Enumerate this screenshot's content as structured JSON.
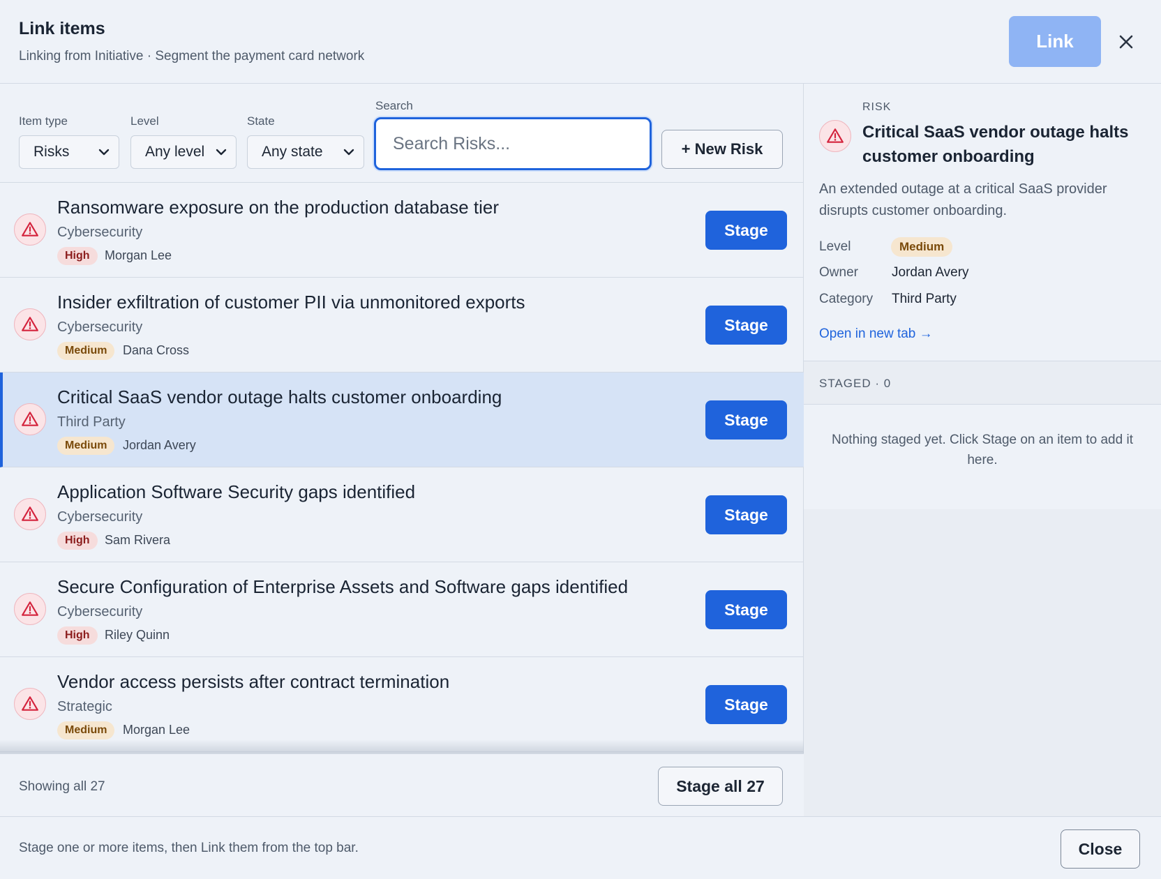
{
  "header": {
    "title": "Link items",
    "subtitle": "Linking from Initiative · Segment the payment card network",
    "link_label": "Link",
    "close_icon": "close-icon"
  },
  "filters": {
    "item_type_label": "Item type",
    "item_type_value": "Risks",
    "level_label": "Level",
    "level_value": "Any level",
    "state_label": "State",
    "state_value": "Any state",
    "search_label": "Search",
    "search_placeholder": "Search Risks...",
    "new_label": "+ New Risk"
  },
  "rows": [
    {
      "title": "Ransomware exposure on the production database tier",
      "category": "Cybersecurity",
      "level": "High",
      "owner": "Morgan Lee",
      "stage_label": "Stage"
    },
    {
      "title": "Insider exfiltration of customer PII via unmonitored exports",
      "category": "Cybersecurity",
      "level": "Medium",
      "owner": "Dana Cross",
      "stage_label": "Stage"
    },
    {
      "title": "Critical SaaS vendor outage halts customer onboarding",
      "category": "Third Party",
      "level": "Medium",
      "owner": "Jordan Avery",
      "stage_label": "Stage"
    },
    {
      "title": "Application Software Security gaps identified",
      "category": "Cybersecurity",
      "level": "High",
      "owner": "Sam Rivera",
      "stage_label": "Stage"
    },
    {
      "title": "Secure Configuration of Enterprise Assets and Software gaps identified",
      "category": "Cybersecurity",
      "level": "High",
      "owner": "Riley Quinn",
      "stage_label": "Stage"
    },
    {
      "title": "Vendor access persists after contract termination",
      "category": "Strategic",
      "level": "Medium",
      "owner": "Morgan Lee",
      "stage_label": "Stage"
    }
  ],
  "list_footer": {
    "showing": "Showing all 27",
    "stage_all": "Stage all 27"
  },
  "detail": {
    "type": "RISK",
    "title": "Critical SaaS vendor outage halts customer onboarding",
    "description": "An extended outage at a critical SaaS provider disrupts customer onboarding.",
    "level_key": "Level",
    "level_value": "Medium",
    "owner_key": "Owner",
    "owner_value": "Jordan Avery",
    "category_key": "Category",
    "category_value": "Third Party",
    "open_link": "Open in new tab →"
  },
  "staged": {
    "header": "STAGED · 0",
    "empty": "Nothing staged yet. Click Stage on an item to add it here."
  },
  "footer": {
    "hint": "Stage one or more items, then Link them from the top bar.",
    "close_label": "Close"
  },
  "colors": {
    "accent": "#1f63dc",
    "link_disabled": "#8fb4f4",
    "high_badge": "#f6dcdc",
    "medium_badge": "#f6e6cf",
    "risk_icon": "#d4233d"
  }
}
